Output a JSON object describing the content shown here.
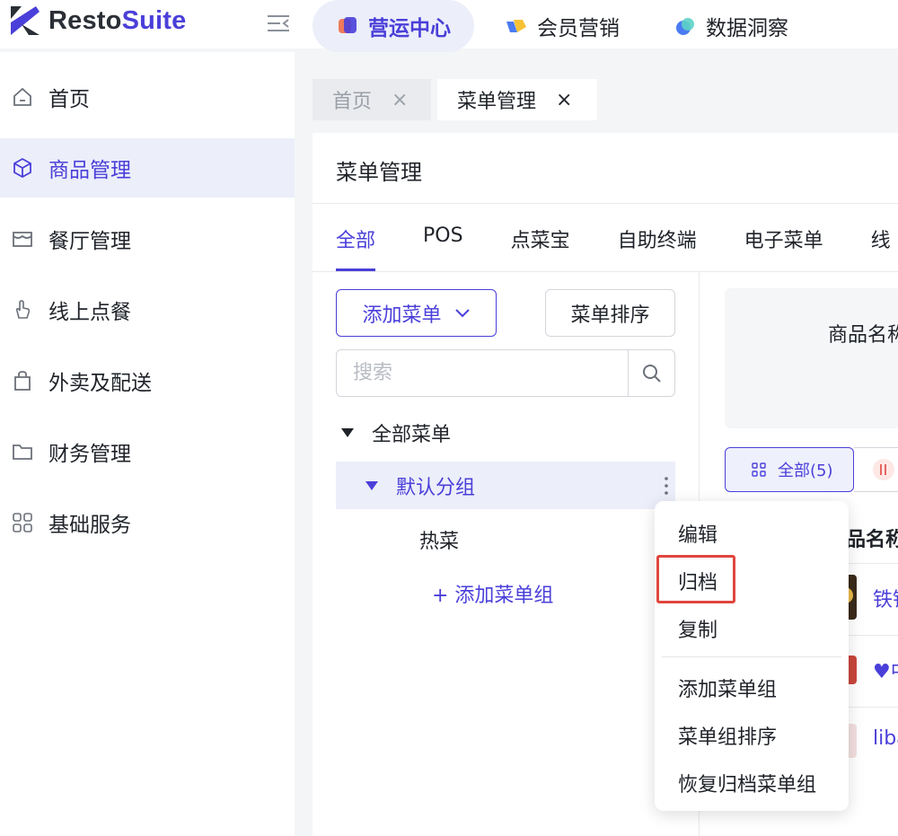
{
  "brand": {
    "name_prefix": "Resto",
    "name_suffix": "Suite",
    "accent": "#4a3fd9"
  },
  "topnav": [
    {
      "label": "营运中心",
      "active": true,
      "icon": "ops-center-icon"
    },
    {
      "label": "会员营销",
      "active": false,
      "icon": "member-marketing-icon"
    },
    {
      "label": "数据洞察",
      "active": false,
      "icon": "data-insight-icon"
    }
  ],
  "sidebar": {
    "items": [
      {
        "label": "首页",
        "icon": "home-icon"
      },
      {
        "label": "商品管理",
        "icon": "box-icon",
        "active": true
      },
      {
        "label": "餐厅管理",
        "icon": "store-icon"
      },
      {
        "label": "线上点餐",
        "icon": "hand-tap-icon"
      },
      {
        "label": "外卖及配送",
        "icon": "bag-icon"
      },
      {
        "label": "财务管理",
        "icon": "folder-icon"
      },
      {
        "label": "基础服务",
        "icon": "grid-icon"
      }
    ]
  },
  "page_tabs": [
    {
      "label": "首页",
      "active": false
    },
    {
      "label": "菜单管理",
      "active": true
    }
  ],
  "panel": {
    "title": "菜单管理",
    "channel_tabs": [
      "全部",
      "POS",
      "点菜宝",
      "自助终端",
      "电子菜单",
      "线"
    ],
    "add_menu_label": "添加菜单",
    "sort_menu_label": "菜单排序",
    "search_placeholder": "搜索",
    "tree": {
      "root": "全部菜单",
      "group": "默认分组",
      "child": "热菜",
      "add_group": "+ 添加菜单组"
    },
    "filter_label": "商品名称",
    "category_chip": "全部(5)",
    "column_header": "品名称",
    "products": [
      "铁铂",
      "♥中",
      "liba"
    ]
  },
  "context_menu": {
    "items": [
      "编辑",
      "归档",
      "复制",
      "添加菜单组",
      "菜单组排序",
      "恢复归档菜单组"
    ],
    "highlight_color": "#e0463e"
  }
}
